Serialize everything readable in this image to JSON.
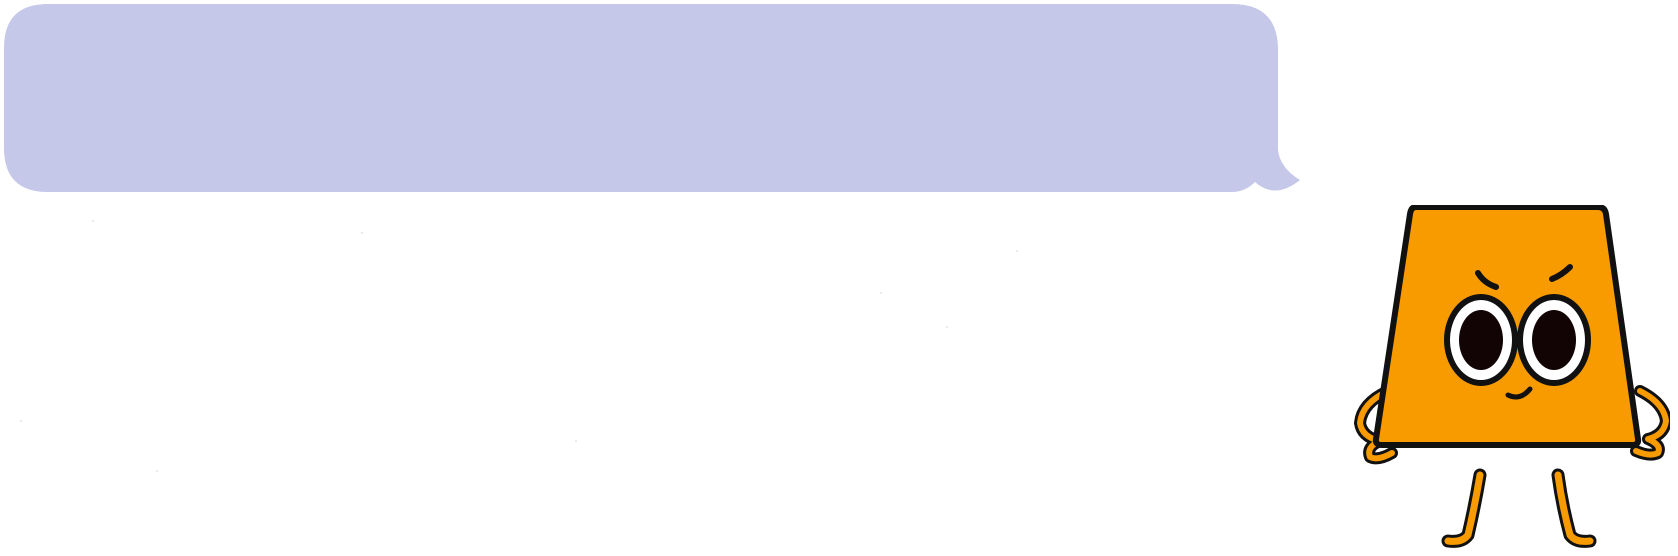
{
  "speech_bubble": {
    "text": "",
    "fill_color": "#c5c8e8"
  },
  "mascot": {
    "body_color": "#f79b00",
    "outline_color": "#111111",
    "eye_white": "#ffffff",
    "pupil_color": "#120404",
    "expression": "determined"
  }
}
